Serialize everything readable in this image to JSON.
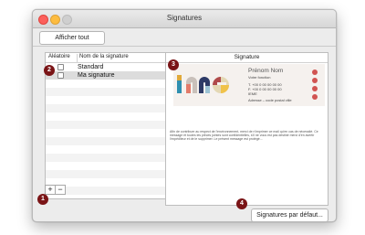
{
  "window": {
    "title": "Signatures"
  },
  "toolbar": {
    "show_all_label": "Afficher tout"
  },
  "list": {
    "header_random": "Aléatoire",
    "header_name": "Nom de la signature",
    "rows": [
      {
        "name": "Standard",
        "checked": false,
        "selected": false
      },
      {
        "name": "Ma signature",
        "checked": false,
        "selected": true
      }
    ]
  },
  "controls": {
    "add_label": "+",
    "remove_label": "−"
  },
  "preview": {
    "header": "Signature",
    "sig": {
      "name": "Prénom Nom",
      "title": "Votre fonction",
      "phone1": "T. +00 0 00 00 00 00",
      "phone2": "F. +00 0 00 00 00 00",
      "email": "IEME",
      "address": "Adresse – code postal ville"
    },
    "note": "Afin de contribuer au respect de l'environnement, merci de n'imprimer ce mail qu'en cas de nécessité. Ce message et toutes les pièces jointes sont confidentielles, s'il ne vous est pas destiné merci d'en avertir l'expéditeur et de le supprimer. Le présent message est protégé..."
  },
  "footer": {
    "default_button": "Signatures par défaut..."
  },
  "badges": [
    "1",
    "2",
    "3",
    "4"
  ]
}
